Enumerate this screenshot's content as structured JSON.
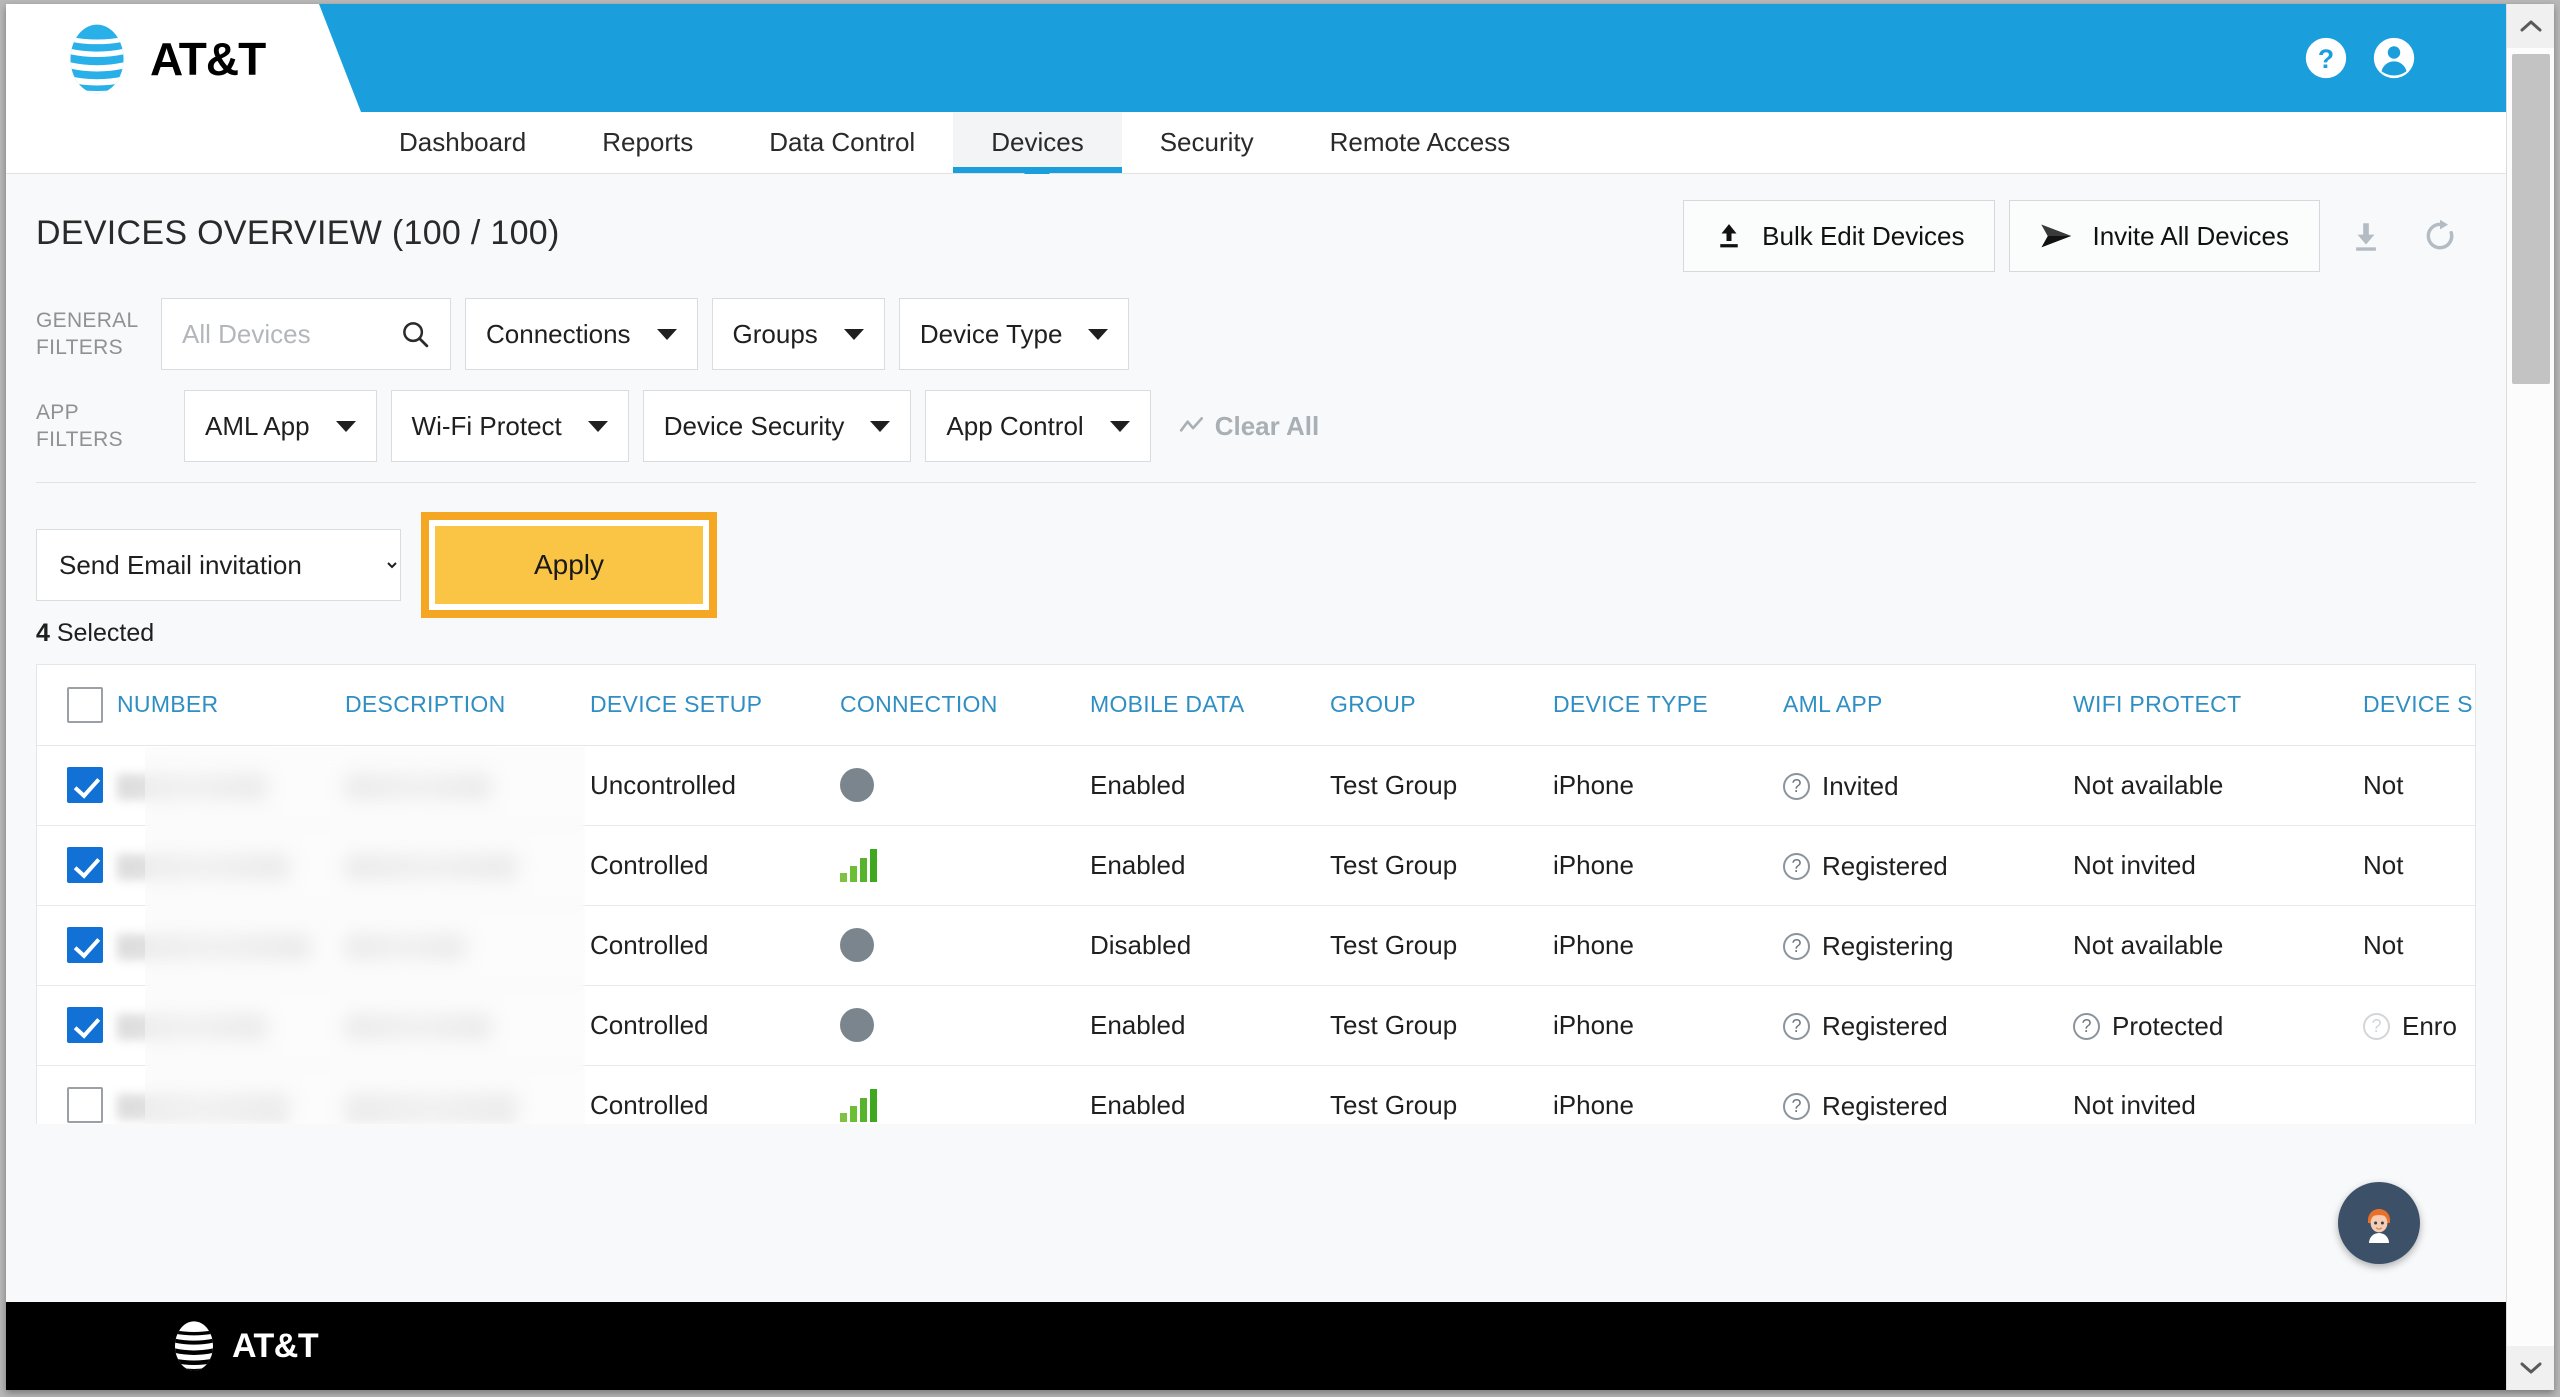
{
  "brand": {
    "name": "AT&T",
    "header_blue": "#1a9fdc",
    "accent_yellow": "#fac545",
    "focus_orange": "#f5a623",
    "link_blue": "#2f8fc4"
  },
  "topbar": {
    "help_icon": "help-circle-icon",
    "account_icon": "user-circle-icon"
  },
  "nav": {
    "tabs": [
      {
        "label": "Dashboard",
        "active": false
      },
      {
        "label": "Reports",
        "active": false
      },
      {
        "label": "Data Control",
        "active": false
      },
      {
        "label": "Devices",
        "active": true
      },
      {
        "label": "Security",
        "active": false
      },
      {
        "label": "Remote Access",
        "active": false
      }
    ]
  },
  "page": {
    "title": "DEVICES OVERVIEW (100 / 100)",
    "actions": {
      "bulk_edit_label": "Bulk Edit Devices",
      "bulk_edit_icon": "upload-icon",
      "invite_all_label": "Invite All Devices",
      "invite_all_icon": "send-icon",
      "download_icon": "download-icon",
      "refresh_icon": "refresh-icon"
    }
  },
  "filters": {
    "general_label": "GENERAL\nFILTERS",
    "general_label_line1": "GENERAL",
    "general_label_line2": "FILTERS",
    "app_label_line1": "APP",
    "app_label_line2": "FILTERS",
    "search": {
      "placeholder": "All Devices",
      "value": "",
      "icon": "search-icon"
    },
    "general_dropdowns": [
      {
        "label": "Connections"
      },
      {
        "label": "Groups"
      },
      {
        "label": "Device Type"
      }
    ],
    "app_dropdowns": [
      {
        "label": "AML App"
      },
      {
        "label": "Wi-Fi Protect"
      },
      {
        "label": "Device Security"
      },
      {
        "label": "App Control"
      }
    ],
    "clear_all_label": "Clear All",
    "clear_all_icon": "clear-filter-icon"
  },
  "actionbar": {
    "bulk_action_selected": "Send Email invitation",
    "bulk_action_options": [
      "Send Email invitation"
    ],
    "apply_label": "Apply",
    "selected_count": "4",
    "selected_suffix": " Selected"
  },
  "table": {
    "select_all_checked": false,
    "columns": [
      "NUMBER",
      "DESCRIPTION",
      "DEVICE SETUP",
      "CONNECTION",
      "MOBILE DATA",
      "GROUP",
      "DEVICE TYPE",
      "AML APP",
      "WIFI PROTECT",
      "DEVICE S"
    ],
    "rows": [
      {
        "checked": true,
        "number": "",
        "description": "",
        "device_setup": "Uncontrolled",
        "connection": "offline",
        "mobile_data": "Enabled",
        "group": "Test Group",
        "device_type": "iPhone",
        "aml_app": "Invited",
        "aml_app_has_icon": true,
        "wifi_protect": "Not available",
        "wifi_protect_has_icon": false,
        "device_security": "Not",
        "device_security_has_icon": false
      },
      {
        "checked": true,
        "number": "",
        "description": "",
        "device_setup": "Controlled",
        "connection": "online",
        "mobile_data": "Enabled",
        "group": "Test Group",
        "device_type": "iPhone",
        "aml_app": "Registered",
        "aml_app_has_icon": true,
        "wifi_protect": "Not invited",
        "wifi_protect_has_icon": false,
        "device_security": "Not",
        "device_security_has_icon": false
      },
      {
        "checked": true,
        "number": "",
        "description": "",
        "device_setup": "Controlled",
        "connection": "offline",
        "mobile_data": "Disabled",
        "group": "Test Group",
        "device_type": "iPhone",
        "aml_app": "Registering",
        "aml_app_has_icon": true,
        "wifi_protect": "Not available",
        "wifi_protect_has_icon": false,
        "device_security": "Not",
        "device_security_has_icon": false
      },
      {
        "checked": true,
        "number": "",
        "description": "",
        "device_setup": "Controlled",
        "connection": "offline",
        "mobile_data": "Enabled",
        "group": "Test Group",
        "device_type": "iPhone",
        "aml_app": "Registered",
        "aml_app_has_icon": true,
        "wifi_protect": "Protected",
        "wifi_protect_has_icon": true,
        "device_security": "Enro",
        "device_security_has_icon": true
      },
      {
        "checked": false,
        "number": "",
        "description": "",
        "device_setup": "Controlled",
        "connection": "online",
        "mobile_data": "Enabled",
        "group": "Test Group",
        "device_type": "iPhone",
        "aml_app": "Registered",
        "aml_app_has_icon": true,
        "wifi_protect": "Not invited",
        "wifi_protect_has_icon": false,
        "device_security": "",
        "device_security_has_icon": false
      }
    ]
  },
  "chat_widget": {
    "icon": "support-agent-avatar-icon"
  },
  "footer": {
    "brand": "AT&T"
  },
  "browser_scrollbar": {
    "up_icon": "chevron-up-icon",
    "down_icon": "chevron-down-icon"
  }
}
